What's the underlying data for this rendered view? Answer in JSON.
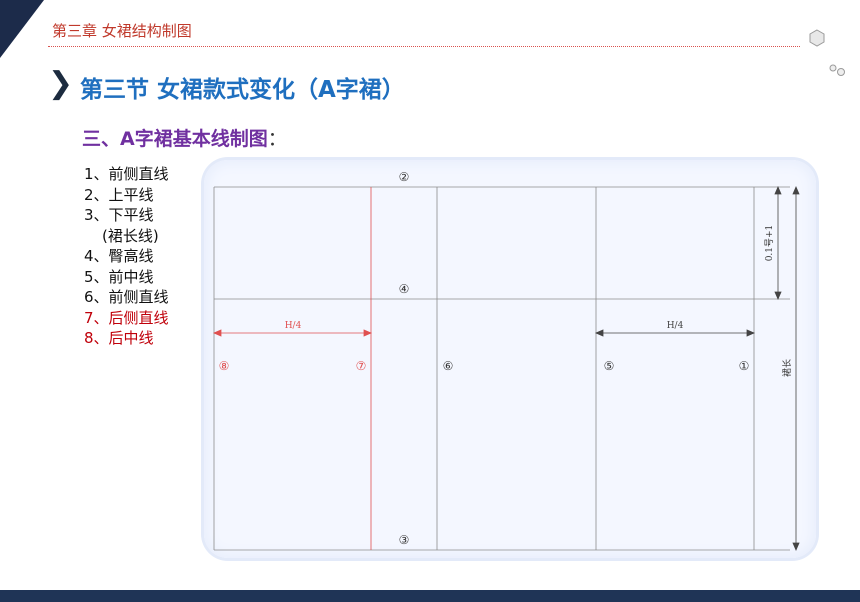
{
  "header": {
    "chapter": "第三章  女裙结构制图"
  },
  "section": {
    "title": "第三节  女裙款式变化（A字裙）",
    "subtitle": "三、A字裙基本线制图：",
    "subtitle_main": "三、A字裙基本线制图",
    "subtitle_colon": "："
  },
  "steps": [
    {
      "text": "1、前侧直线",
      "color": "black"
    },
    {
      "text": "2、上平线",
      "color": "black"
    },
    {
      "text": "3、下平线",
      "color": "black"
    },
    {
      "text": "(裙长线)",
      "color": "black"
    },
    {
      "text": "4、臀高线",
      "color": "black"
    },
    {
      "text": "5、前中线",
      "color": "black"
    },
    {
      "text": "6、前侧直线",
      "color": "black"
    },
    {
      "text": "7、后侧直线",
      "color": "red"
    },
    {
      "text": "8、后中线",
      "color": "red"
    }
  ],
  "diagram": {
    "markers": {
      "m1": "①",
      "m2": "②",
      "m3": "③",
      "m4": "④",
      "m5": "⑤",
      "m6": "⑥",
      "m7": "⑦",
      "m8": "⑧"
    },
    "dim_left": "H/4",
    "dim_right": "H/4",
    "dim_hip": "0.1号+1",
    "dim_length": "裙长"
  },
  "colors": {
    "chapter": "#c0392b",
    "title": "#1f6fbf",
    "subtitle": "#7030a0",
    "red_line": "#e05050",
    "footer": "#1f3456"
  }
}
